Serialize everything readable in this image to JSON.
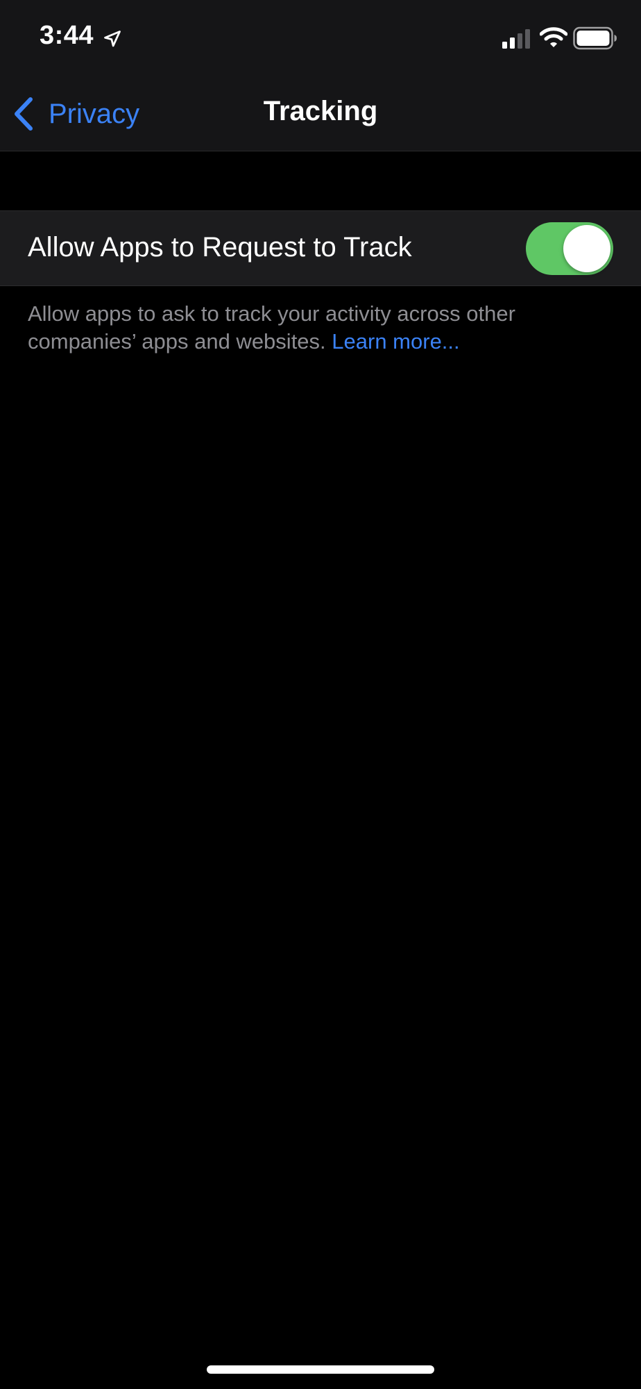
{
  "status_bar": {
    "time": "3:44",
    "icons": [
      "location-arrow-icon",
      "cellular-signal-icon",
      "wifi-icon",
      "battery-icon"
    ]
  },
  "nav": {
    "back_label": "Privacy",
    "title": "Tracking"
  },
  "setting": {
    "label": "Allow Apps to Request to Track",
    "enabled": true
  },
  "footer": {
    "text": "Allow apps to ask to track your activity across other companies’ apps and websites.",
    "link_label": "Learn more..."
  },
  "colors": {
    "accent": "#3b82f6",
    "toggle_on": "#5fc765",
    "background": "#000000",
    "bar_background": "#151517",
    "cell_background": "#1c1c1e",
    "secondary_text": "#8e8e93"
  }
}
